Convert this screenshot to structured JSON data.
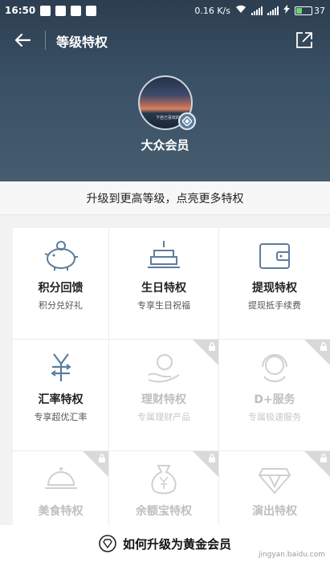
{
  "status_bar": {
    "time": "16:50",
    "network_speed": "0.16 K/s",
    "battery": "37"
  },
  "nav": {
    "title": "等级特权"
  },
  "profile": {
    "avatar_caption": "下自己喜欢的事情",
    "level_name": "大众会员"
  },
  "banner": {
    "text": "升级到更高等级，点亮更多特权"
  },
  "privileges": [
    {
      "title": "积分回馈",
      "subtitle": "积分兑好礼",
      "icon": "piggy-bank-icon",
      "locked": false
    },
    {
      "title": "生日特权",
      "subtitle": "专享生日祝福",
      "icon": "birthday-cake-icon",
      "locked": false
    },
    {
      "title": "提现特权",
      "subtitle": "提现抵手续费",
      "icon": "wallet-icon",
      "locked": false
    },
    {
      "title": "汇率特权",
      "subtitle": "专享超优汇率",
      "icon": "exchange-yen-icon",
      "locked": false
    },
    {
      "title": "理财特权",
      "subtitle": "专属理财产品",
      "icon": "hand-coin-icon",
      "locked": true
    },
    {
      "title": "D+服务",
      "subtitle": "专属极速服务",
      "icon": "headset-icon",
      "locked": true
    },
    {
      "title": "美食特权",
      "subtitle": "",
      "icon": "food-cloche-icon",
      "locked": true
    },
    {
      "title": "余额宝特权",
      "subtitle": "",
      "icon": "money-bag-icon",
      "locked": true
    },
    {
      "title": "演出特权",
      "subtitle": "",
      "icon": "diamond-icon",
      "locked": true
    }
  ],
  "bottom": {
    "text": "如何升级为黄金会员"
  },
  "watermark": "jingyan.baidu.com",
  "colors": {
    "header_bg": "#2c3e50",
    "icon_active": "#5b7d9d",
    "icon_locked": "#d0d0d0"
  }
}
